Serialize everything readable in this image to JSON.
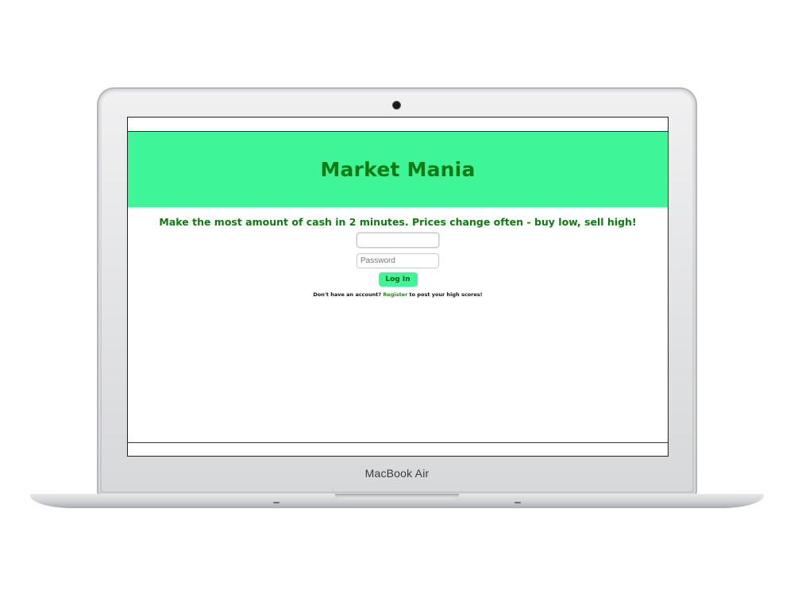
{
  "device": {
    "brand_label": "MacBook Air"
  },
  "app": {
    "title": "Market Mania",
    "tagline": "Make the most amount of cash in 2 minutes. Prices change often - buy low, sell high!",
    "username_field": {
      "value": "",
      "placeholder": ""
    },
    "password_field": {
      "value": "",
      "placeholder": "Password"
    },
    "login_button_label": "Log In",
    "register_prompt": {
      "before": "Don't have an account? ",
      "link_label": "Register",
      "after": " to post your high scores!"
    }
  },
  "colors": {
    "banner_bg": "#3ef597",
    "heading_text": "#0f7a0f",
    "button_bg": "#3ef597",
    "link_text": "#1a8a1a"
  }
}
